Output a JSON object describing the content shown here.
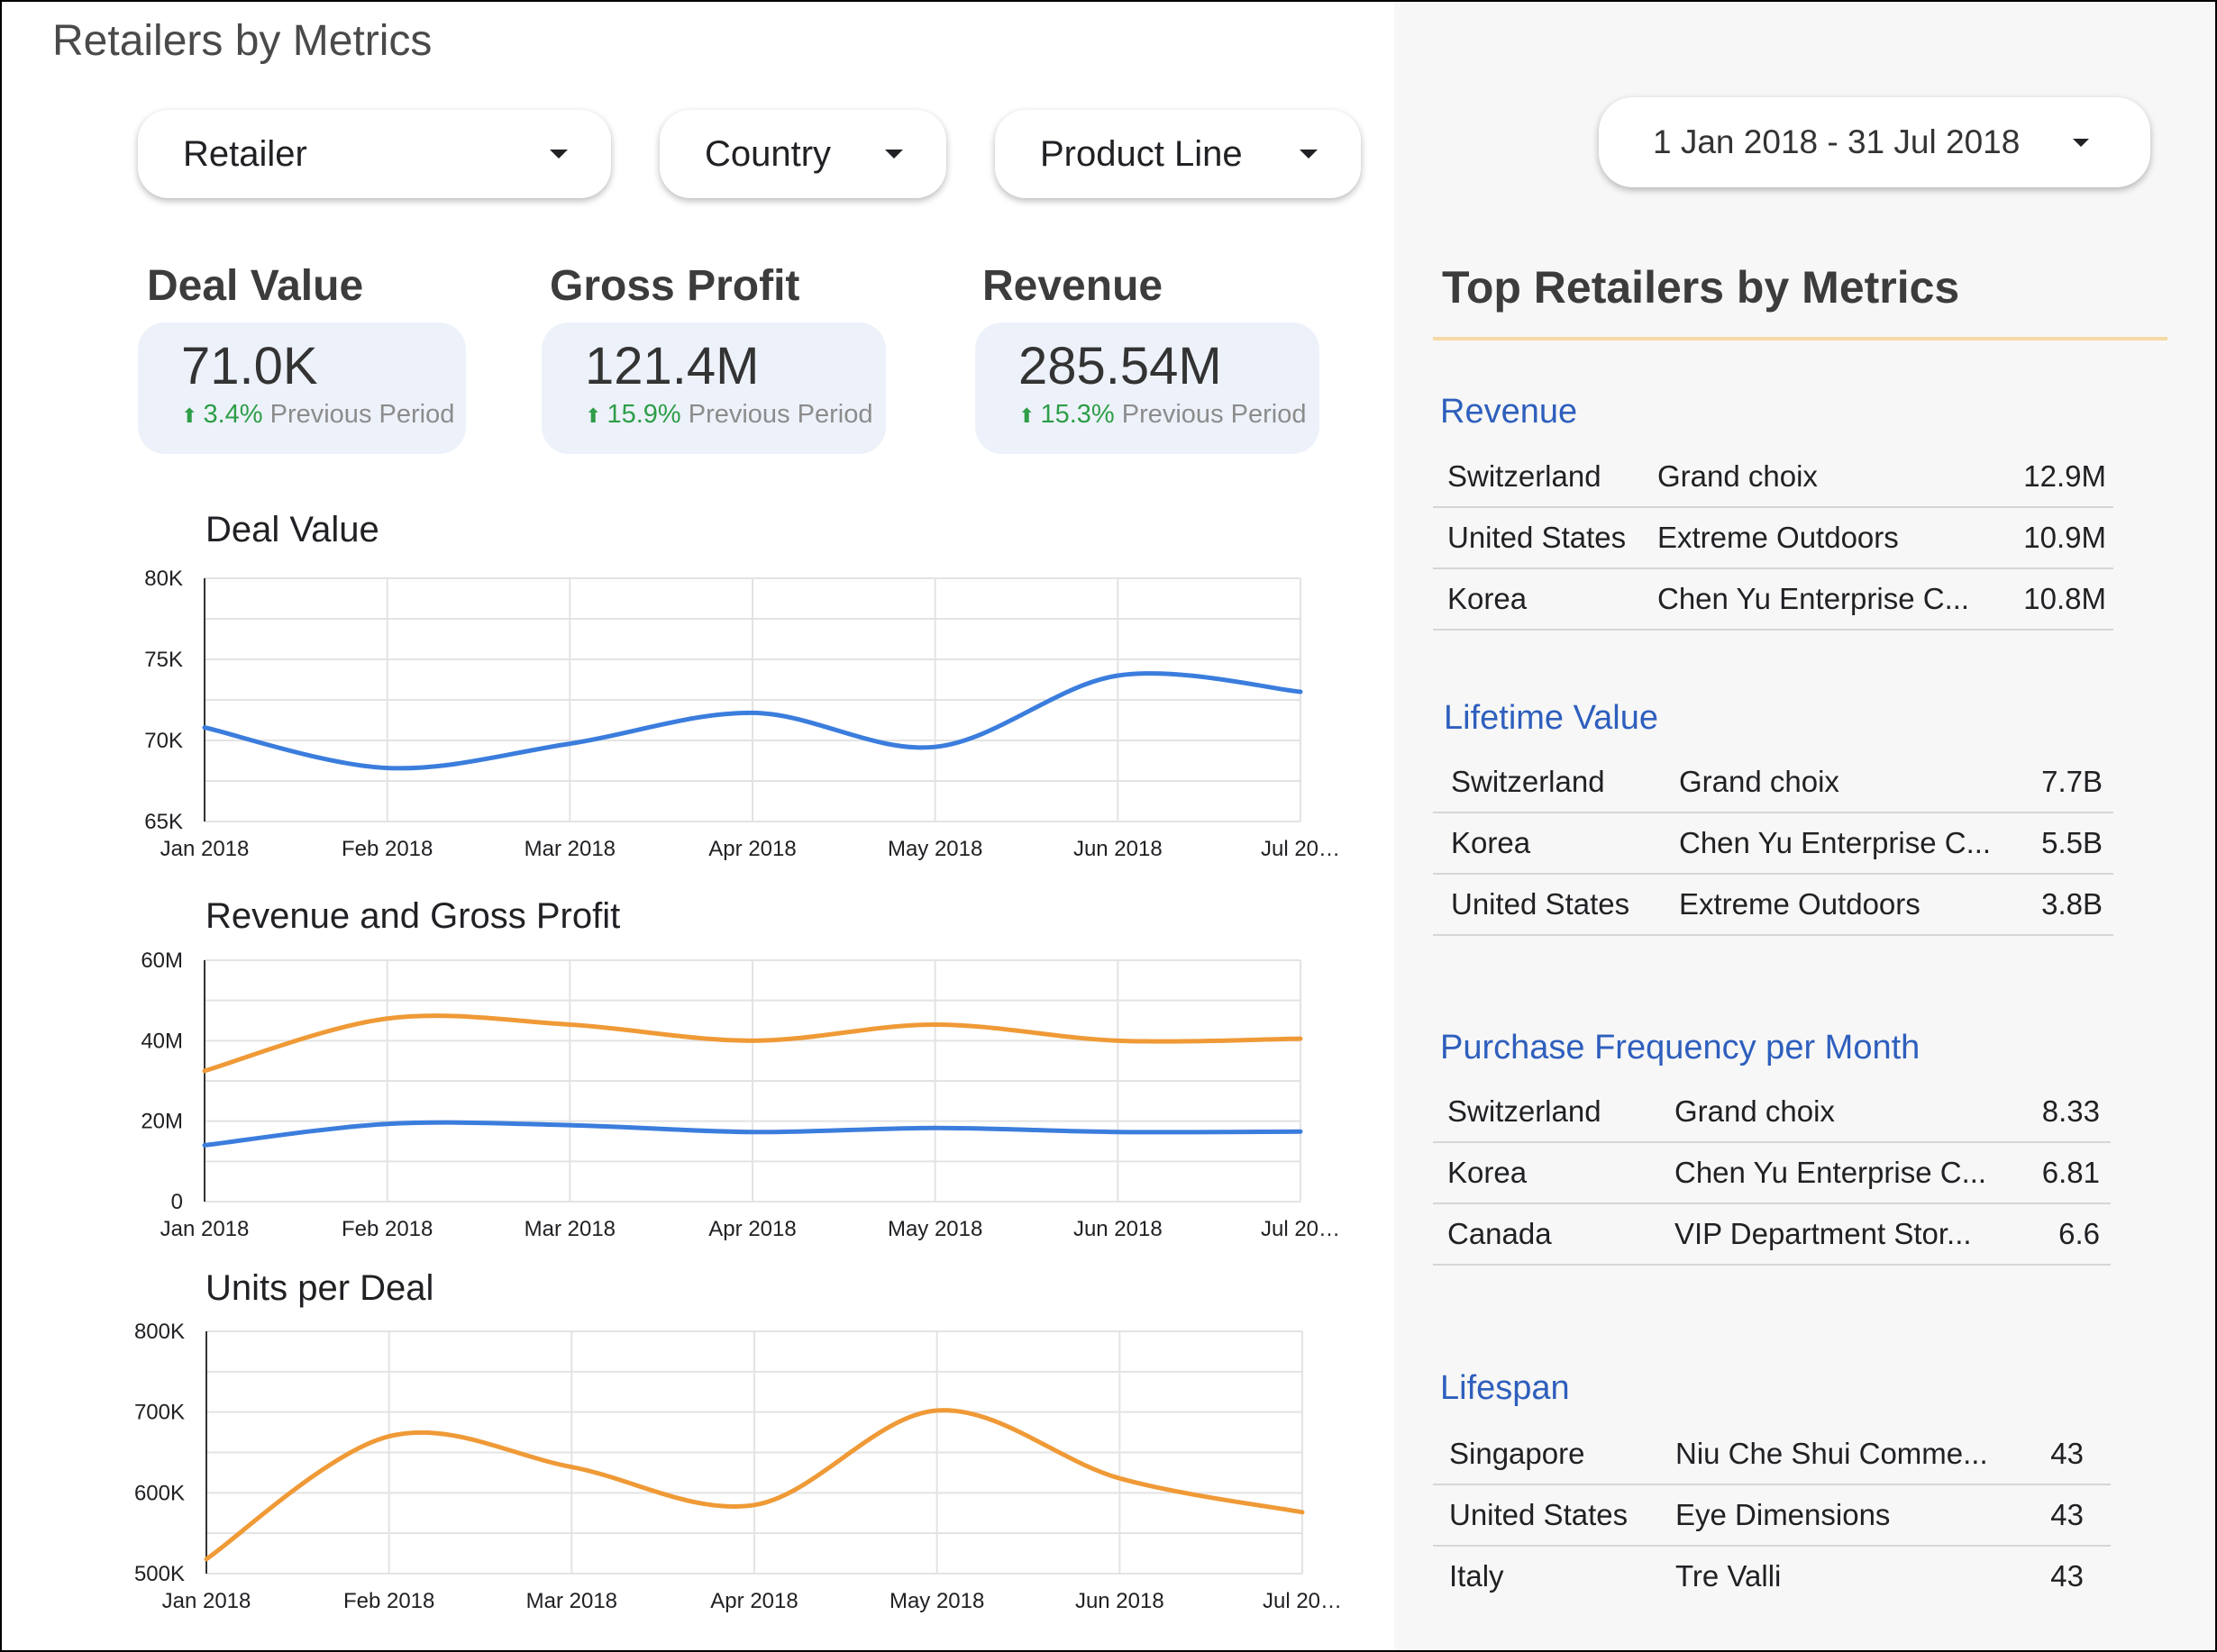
{
  "page_title": "Retailers by Metrics",
  "filters": {
    "retailer": "Retailer",
    "country": "Country",
    "product_line": "Product Line",
    "date_range": "1 Jan 2018 - 31 Jul 2018"
  },
  "kpis": [
    {
      "label": "Deal Value",
      "value": "71.0K",
      "change": "3.4%",
      "period": "Previous Period"
    },
    {
      "label": "Gross Profit",
      "value": "121.4M",
      "change": "15.9%",
      "period": "Previous Period"
    },
    {
      "label": "Revenue",
      "value": "285.54M",
      "change": "15.3%",
      "period": "Previous Period"
    }
  ],
  "charts": {
    "deal_value_title": "Deal Value",
    "revenue_gp_title": "Revenue and Gross Profit",
    "units_per_deal_title": "Units per Deal"
  },
  "chart_data": [
    {
      "type": "line",
      "title": "Deal Value",
      "categories": [
        "Jan 2018",
        "Feb 2018",
        "Mar 2018",
        "Apr 2018",
        "May 2018",
        "Jun 2018",
        "Jul 20…"
      ],
      "series": [
        {
          "values": [
            70800,
            68300,
            69800,
            71700,
            69600,
            74000,
            73000
          ],
          "color": "#3b7ddd"
        }
      ],
      "yticks": [
        "65K",
        "70K",
        "75K",
        "80K"
      ],
      "ylim": [
        65000,
        80000
      ],
      "grid": true
    },
    {
      "type": "line",
      "title": "Revenue and Gross Profit",
      "categories": [
        "Jan 2018",
        "Feb 2018",
        "Mar 2018",
        "Apr 2018",
        "May 2018",
        "Jun 2018",
        "Jul 20…"
      ],
      "series": [
        {
          "values": [
            32500000,
            45500000,
            44000000,
            40000000,
            44000000,
            40000000,
            40500000
          ],
          "color": "#ef9a37"
        },
        {
          "values": [
            14000000,
            19300000,
            19000000,
            17300000,
            18300000,
            17300000,
            17400000
          ],
          "color": "#3b7ddd"
        }
      ],
      "yticks": [
        "0",
        "20M",
        "40M",
        "60M"
      ],
      "ylim": [
        0,
        60000000
      ],
      "grid": true
    },
    {
      "type": "line",
      "title": "Units per Deal",
      "categories": [
        "Jan 2018",
        "Feb 2018",
        "Mar 2018",
        "Apr 2018",
        "May 2018",
        "Jun 2018",
        "Jul 20…"
      ],
      "series": [
        {
          "values": [
            518000,
            670000,
            632000,
            585000,
            702000,
            618000,
            576000
          ],
          "color": "#ef9a37"
        }
      ],
      "yticks": [
        "500K",
        "600K",
        "700K",
        "800K"
      ],
      "ylim": [
        500000,
        800000
      ],
      "grid": true
    }
  ],
  "right_panel": {
    "title": "Top Retailers by Metrics",
    "sections": [
      {
        "title": "Revenue",
        "rows": [
          {
            "country": "Switzerland",
            "retailer": "Grand choix",
            "value": "12.9M"
          },
          {
            "country": "United States",
            "retailer": "Extreme Outdoors",
            "value": "10.9M"
          },
          {
            "country": "Korea",
            "retailer": "Chen Yu Enterprise C...",
            "value": "10.8M"
          }
        ]
      },
      {
        "title": "Lifetime Value",
        "rows": [
          {
            "country": "Switzerland",
            "retailer": "Grand choix",
            "value": "7.7B"
          },
          {
            "country": "Korea",
            "retailer": "Chen Yu Enterprise C...",
            "value": "5.5B"
          },
          {
            "country": "United States",
            "retailer": "Extreme Outdoors",
            "value": "3.8B"
          }
        ]
      },
      {
        "title": "Purchase Frequency per Month",
        "rows": [
          {
            "country": "Switzerland",
            "retailer": "Grand choix",
            "value": "8.33"
          },
          {
            "country": "Korea",
            "retailer": "Chen Yu Enterprise C...",
            "value": "6.81"
          },
          {
            "country": "Canada",
            "retailer": "VIP Department Stor...",
            "value": "6.6"
          }
        ]
      },
      {
        "title": "Lifespan",
        "rows": [
          {
            "country": "Singapore",
            "retailer": "Niu Che Shui Comme...",
            "value": "43"
          },
          {
            "country": "United States",
            "retailer": "Eye Dimensions",
            "value": "43"
          },
          {
            "country": "Italy",
            "retailer": "Tre Valli",
            "value": "43"
          }
        ]
      }
    ]
  }
}
